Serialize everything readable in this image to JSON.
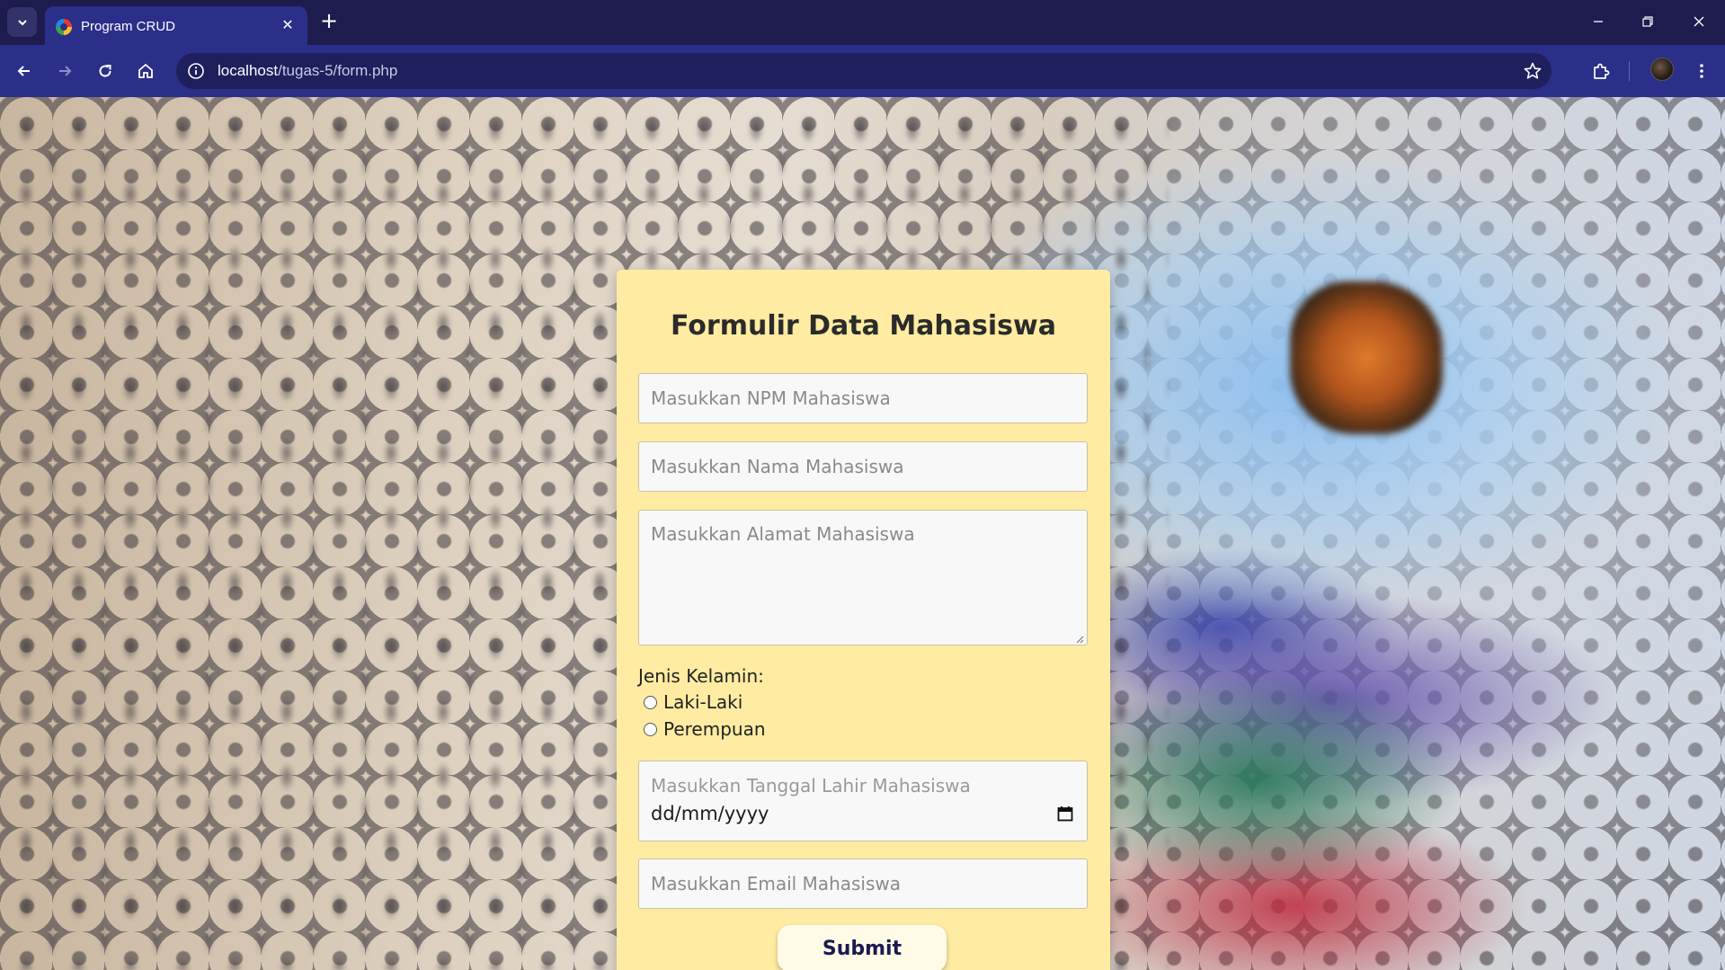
{
  "browser": {
    "tab_title": "Program CRUD",
    "url_host": "localhost",
    "url_path": "/tugas-5/form.php"
  },
  "form": {
    "title": "Formulir Data Mahasiswa",
    "npm_placeholder": "Masukkan NPM Mahasiswa",
    "nama_placeholder": "Masukkan Nama Mahasiswa",
    "alamat_placeholder": "Masukkan Alamat Mahasiswa",
    "gender_label": "Jenis Kelamin:",
    "gender_options": [
      "Laki-Laki",
      "Perempuan"
    ],
    "tanggal_placeholder": "Masukkan Tanggal Lahir Mahasiswa",
    "tanggal_value": "dd/mm/yyyy",
    "email_placeholder": "Masukkan Email Mahasiswa",
    "submit_label": "Submit"
  },
  "colors": {
    "tabbar": "#1e1b4f",
    "toolbar": "#2b2f8a",
    "card": "#ffeca2",
    "button_text": "#1b1b4f"
  },
  "icons": [
    "tab-list-icon",
    "chrome-favicon",
    "close-icon",
    "plus-icon",
    "minimize-icon",
    "restore-icon",
    "window-close-icon",
    "back-icon",
    "forward-icon",
    "reload-icon",
    "home-icon",
    "site-info-icon",
    "bookmark-star-icon",
    "extensions-icon",
    "profile-avatar",
    "menu-icon",
    "calendar-icon"
  ]
}
